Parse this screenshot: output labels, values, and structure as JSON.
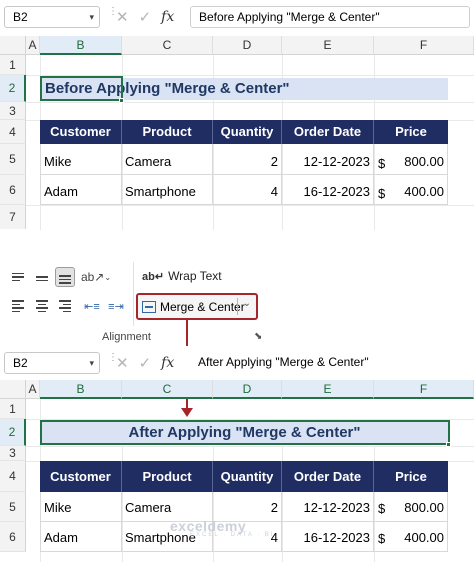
{
  "formula_bar_top": {
    "cell_ref": "B2",
    "formula": "Before Applying \"Merge & Center\""
  },
  "formula_bar_bottom": {
    "cell_ref": "B2",
    "formula": "After Applying \"Merge & Center\""
  },
  "icons": {
    "cancel": "✕",
    "enter": "✓",
    "fx": "fx"
  },
  "columns": [
    "A",
    "B",
    "C",
    "D",
    "E",
    "F"
  ],
  "rows_top": [
    "1",
    "2",
    "3",
    "4",
    "5",
    "6",
    "7"
  ],
  "rows_bottom": [
    "1",
    "2",
    "3",
    "4",
    "5",
    "6"
  ],
  "before_title": "Before Applying \"Merge & Center\"",
  "after_title": "After Applying \"Merge & Center\"",
  "table_headers": [
    "Customer",
    "Product",
    "Quantity",
    "Order Date",
    "Price"
  ],
  "table_rows": [
    {
      "customer": "Mike",
      "product": "Camera",
      "quantity": "2",
      "order_date": "12-12-2023",
      "currency": "$",
      "price": "800.00"
    },
    {
      "customer": "Adam",
      "product": "Smartphone",
      "quantity": "4",
      "order_date": "16-12-2023",
      "currency": "$",
      "price": "400.00"
    }
  ],
  "ribbon": {
    "wrap_text": "Wrap Text",
    "merge_center": "Merge & Center",
    "group_label": "Alignment"
  },
  "watermark": {
    "name": "exceldemy",
    "tagline": "EXCEL · DATA · BI"
  },
  "colors": {
    "header_fill": "#1f2d63",
    "title_fill": "#dae3f3",
    "highlight_border": "#a5252a",
    "selection": "#217346"
  }
}
